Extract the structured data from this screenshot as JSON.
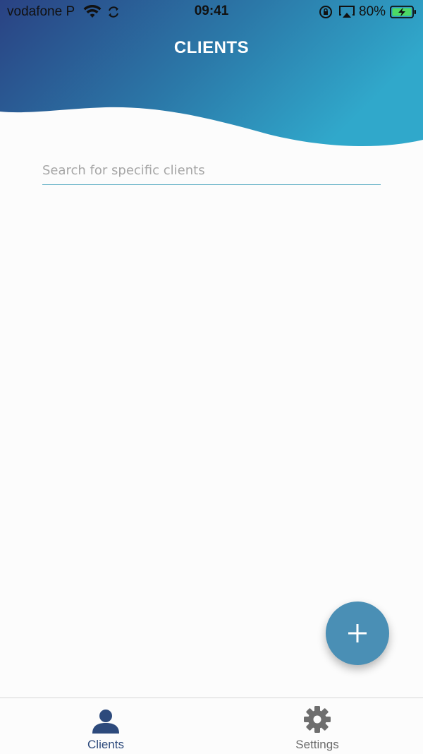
{
  "status_bar": {
    "carrier": "vodafone P",
    "time": "09:41",
    "battery": "80%"
  },
  "header": {
    "title": "CLIENTS",
    "gradient_start": "#2a4a85",
    "gradient_end": "#2fa6c8"
  },
  "search": {
    "placeholder": "Search for specific clients",
    "value": ""
  },
  "fab": {
    "icon": "plus-icon",
    "color": "#4a8fb5"
  },
  "tabs": [
    {
      "label": "Clients",
      "icon": "person-icon",
      "active": true
    },
    {
      "label": "Settings",
      "icon": "gear-icon",
      "active": false
    }
  ]
}
